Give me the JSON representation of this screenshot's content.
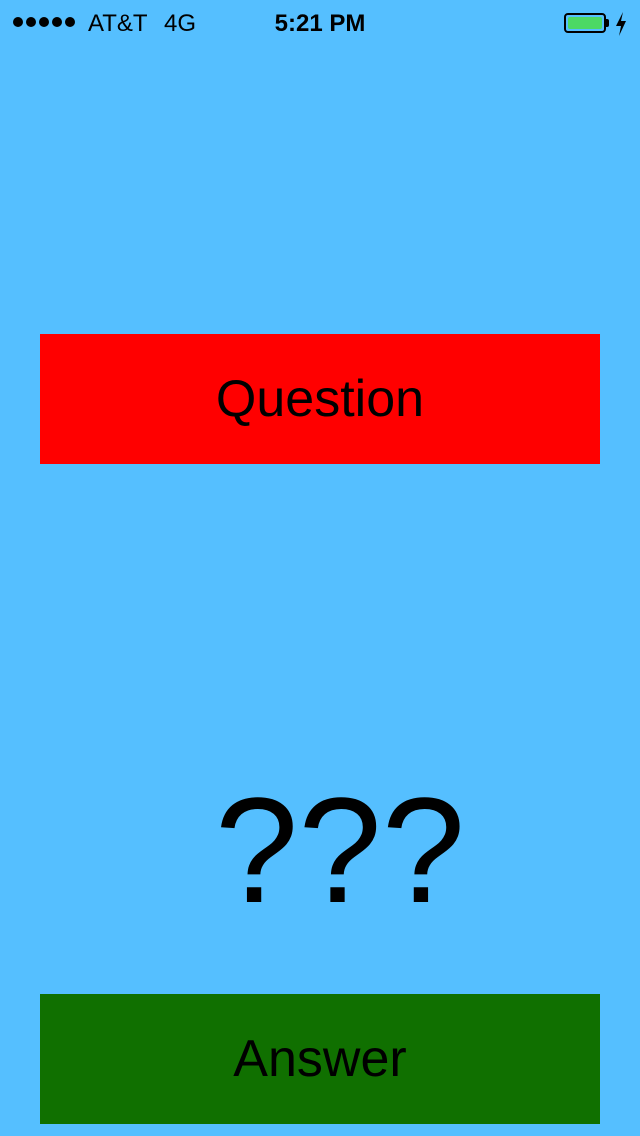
{
  "status_bar": {
    "carrier": "AT&T",
    "network": "4G",
    "time": "5:21 PM",
    "signal_bars": 5,
    "battery_level": 1.0,
    "battery_color": "#4cd964",
    "charging_icon": "charging-bolt-icon"
  },
  "main": {
    "question_label": "Question",
    "question_color": "#ff0000",
    "answer_display": "???",
    "answer_label": "Answer",
    "answer_color": "#107000",
    "background_color": "#55bfff"
  }
}
